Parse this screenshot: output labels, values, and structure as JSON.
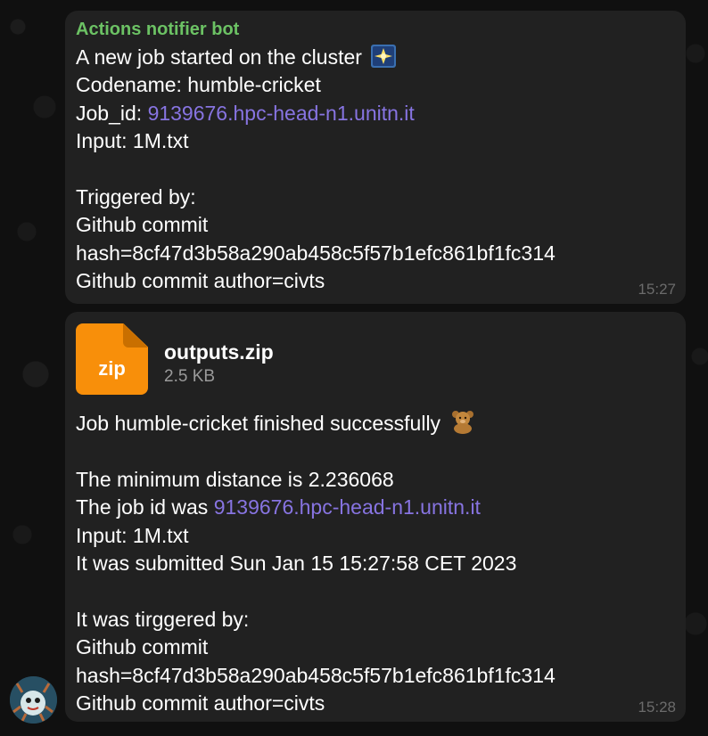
{
  "message1": {
    "sender": "Actions notifier bot",
    "lines": [
      "A new job started on the cluster",
      "Codename: humble-cricket",
      "Job_id: ",
      "Input: 1M.txt",
      "",
      "Triggered by:",
      "Github commit",
      "hash=8cf47d3b58a290ab458c5f57b1efc861bf1fc314",
      "Github commit author=civts"
    ],
    "job_id_prefix": "Job_id: ",
    "job_id_link": "9139676.hpc-head-n1.unitn.it",
    "emoji": "sparkle-picture-icon",
    "time": "15:27"
  },
  "message2": {
    "file": {
      "name": "outputs.zip",
      "size": "2.5 KB",
      "ext": "zip",
      "icon": "zip-file-icon",
      "color": "#f88f0a"
    },
    "line_finished": "Job humble-cricket finished successfully",
    "emoji": "teddy-bear-icon",
    "line_distance": "The minimum distance is 2.236068",
    "job_id_prefix": "The job id was ",
    "job_id_link": "9139676.hpc-head-n1.unitn.it",
    "line_input": "Input: 1M.txt",
    "line_submitted": "It was submitted Sun Jan 15 15:27:58 CET 2023",
    "line_triggered": "It was tirggered by:",
    "line_commit": "Github commit",
    "line_hash": "hash=8cf47d3b58a290ab458c5f57b1efc861bf1fc314",
    "line_author": "Github commit author=civts",
    "time": "15:28"
  },
  "colors": {
    "sender": "#6cc264",
    "link": "#8774e1",
    "bubble": "#212121"
  }
}
